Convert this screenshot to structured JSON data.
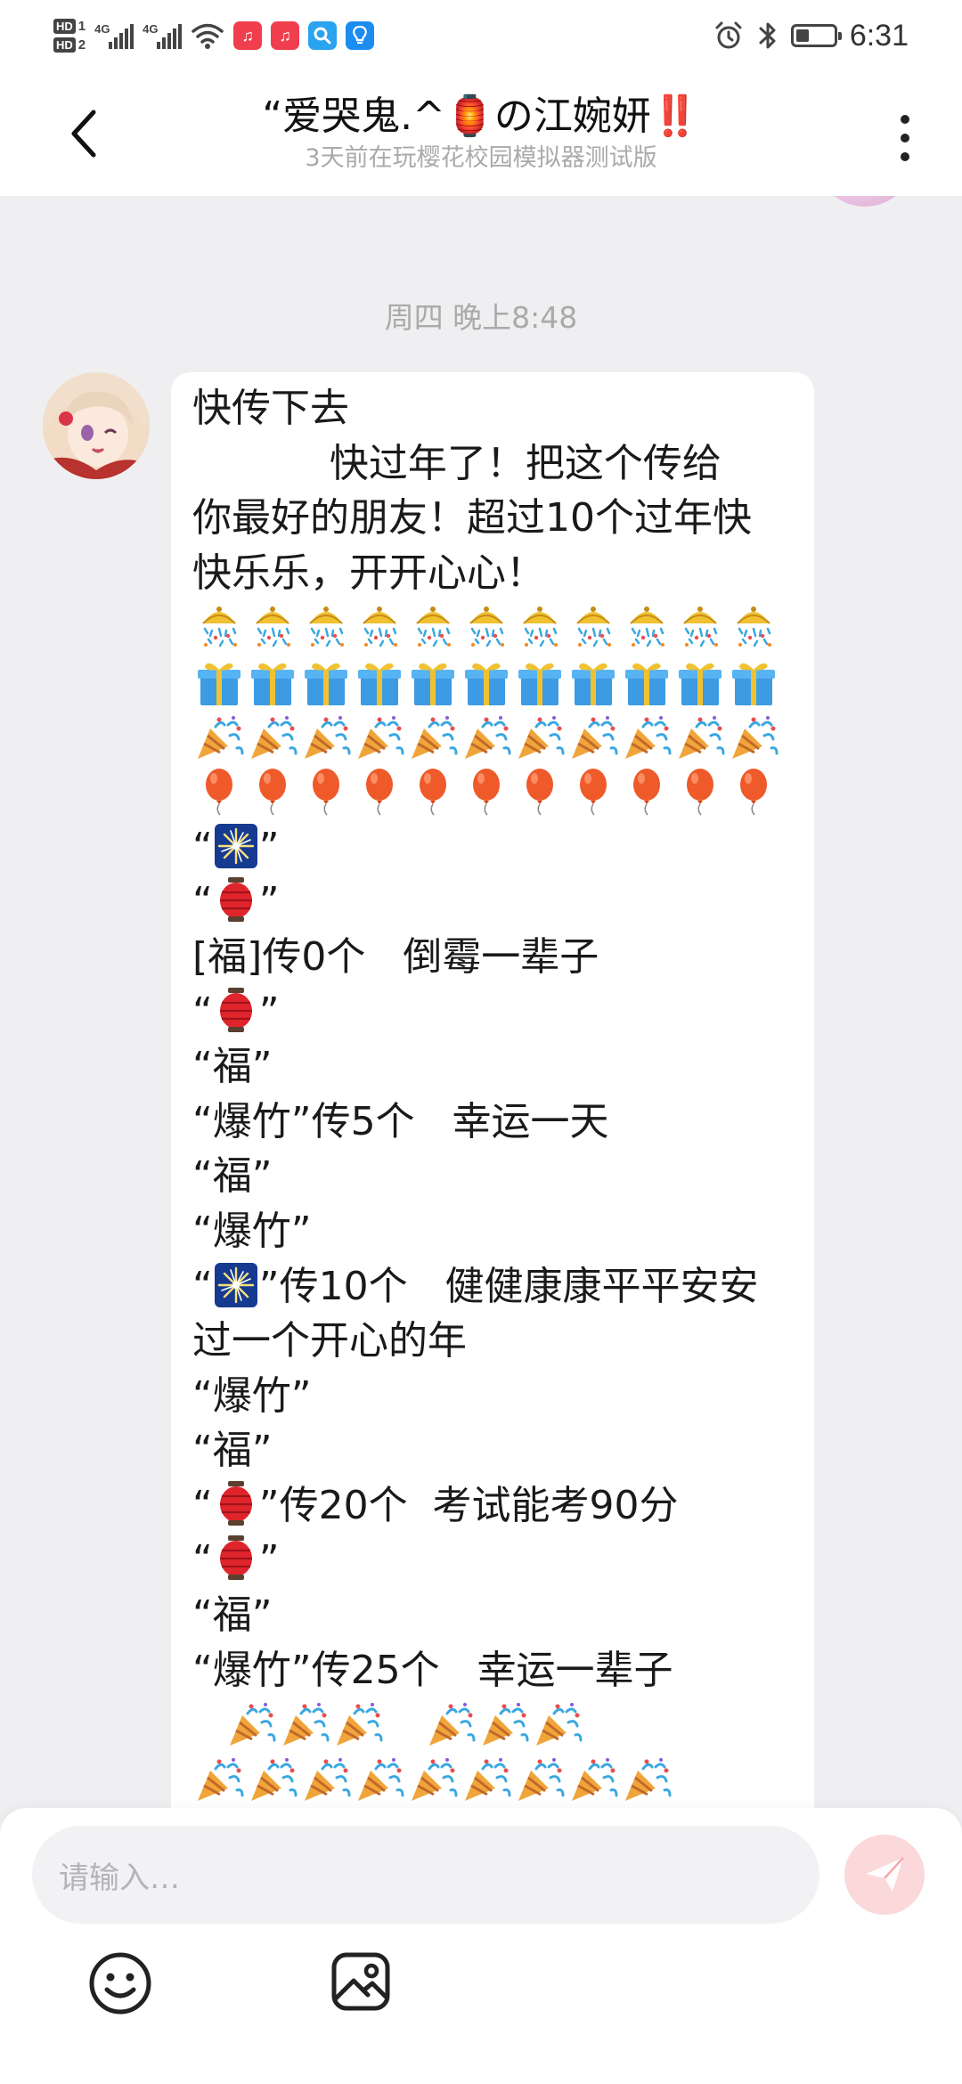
{
  "status_bar": {
    "hd1": "HD",
    "hd1_num": "1",
    "hd2": "HD",
    "hd2_num": "2",
    "sig1_label": "4G",
    "sig2_label": "4G",
    "battery_level": 0.35,
    "time": "6:31",
    "icons": [
      "alarm-icon",
      "bluetooth-icon",
      "battery-icon"
    ],
    "app_icons": [
      "douyin-icon",
      "douyin-icon",
      "search-app-icon",
      "bulb-app-icon"
    ]
  },
  "header": {
    "title": "“爱哭鬼.^🏮の江婉妍‼️",
    "subtitle": "3天前在玩樱花校园模拟器测试版"
  },
  "chat": {
    "timestamp": "周四 晚上8:48",
    "message": {
      "line1": "快传下去",
      "line2": "           快过年了！把这个传给",
      "line3": "你最好的朋友！超过10个过年快",
      "line4": "快乐乐，开开心心！",
      "emoji_row_counts": [
        11,
        11,
        11,
        11
      ],
      "emoji_row_icons": [
        "confetti-ball-icon",
        "gift-icon",
        "party-popper-icon",
        "balloon-icon"
      ],
      "q_open": "“",
      "q_close": "”",
      "line_fu0": "[福]传0个   倒霉一辈子",
      "fu": "“福”",
      "firecracker": "“爆竹”",
      "firecracker_5": "“爆竹”传5个   幸运一天",
      "sparkler_10": "传10个   健健康康平平安安",
      "year_line": "过一个开心的年",
      "lantern_20": "传20个  考试能考90分",
      "firecracker_25": "“爆竹”传25个   幸运一辈子",
      "last_row_a_count": 3,
      "last_row_b_count": 3,
      "last_row_c_count": 9
    }
  },
  "composer": {
    "placeholder": "请输入…",
    "send_color": "#f6a8ab"
  },
  "colors": {
    "accent": "#f6a8ab",
    "background": "#efeff1"
  }
}
